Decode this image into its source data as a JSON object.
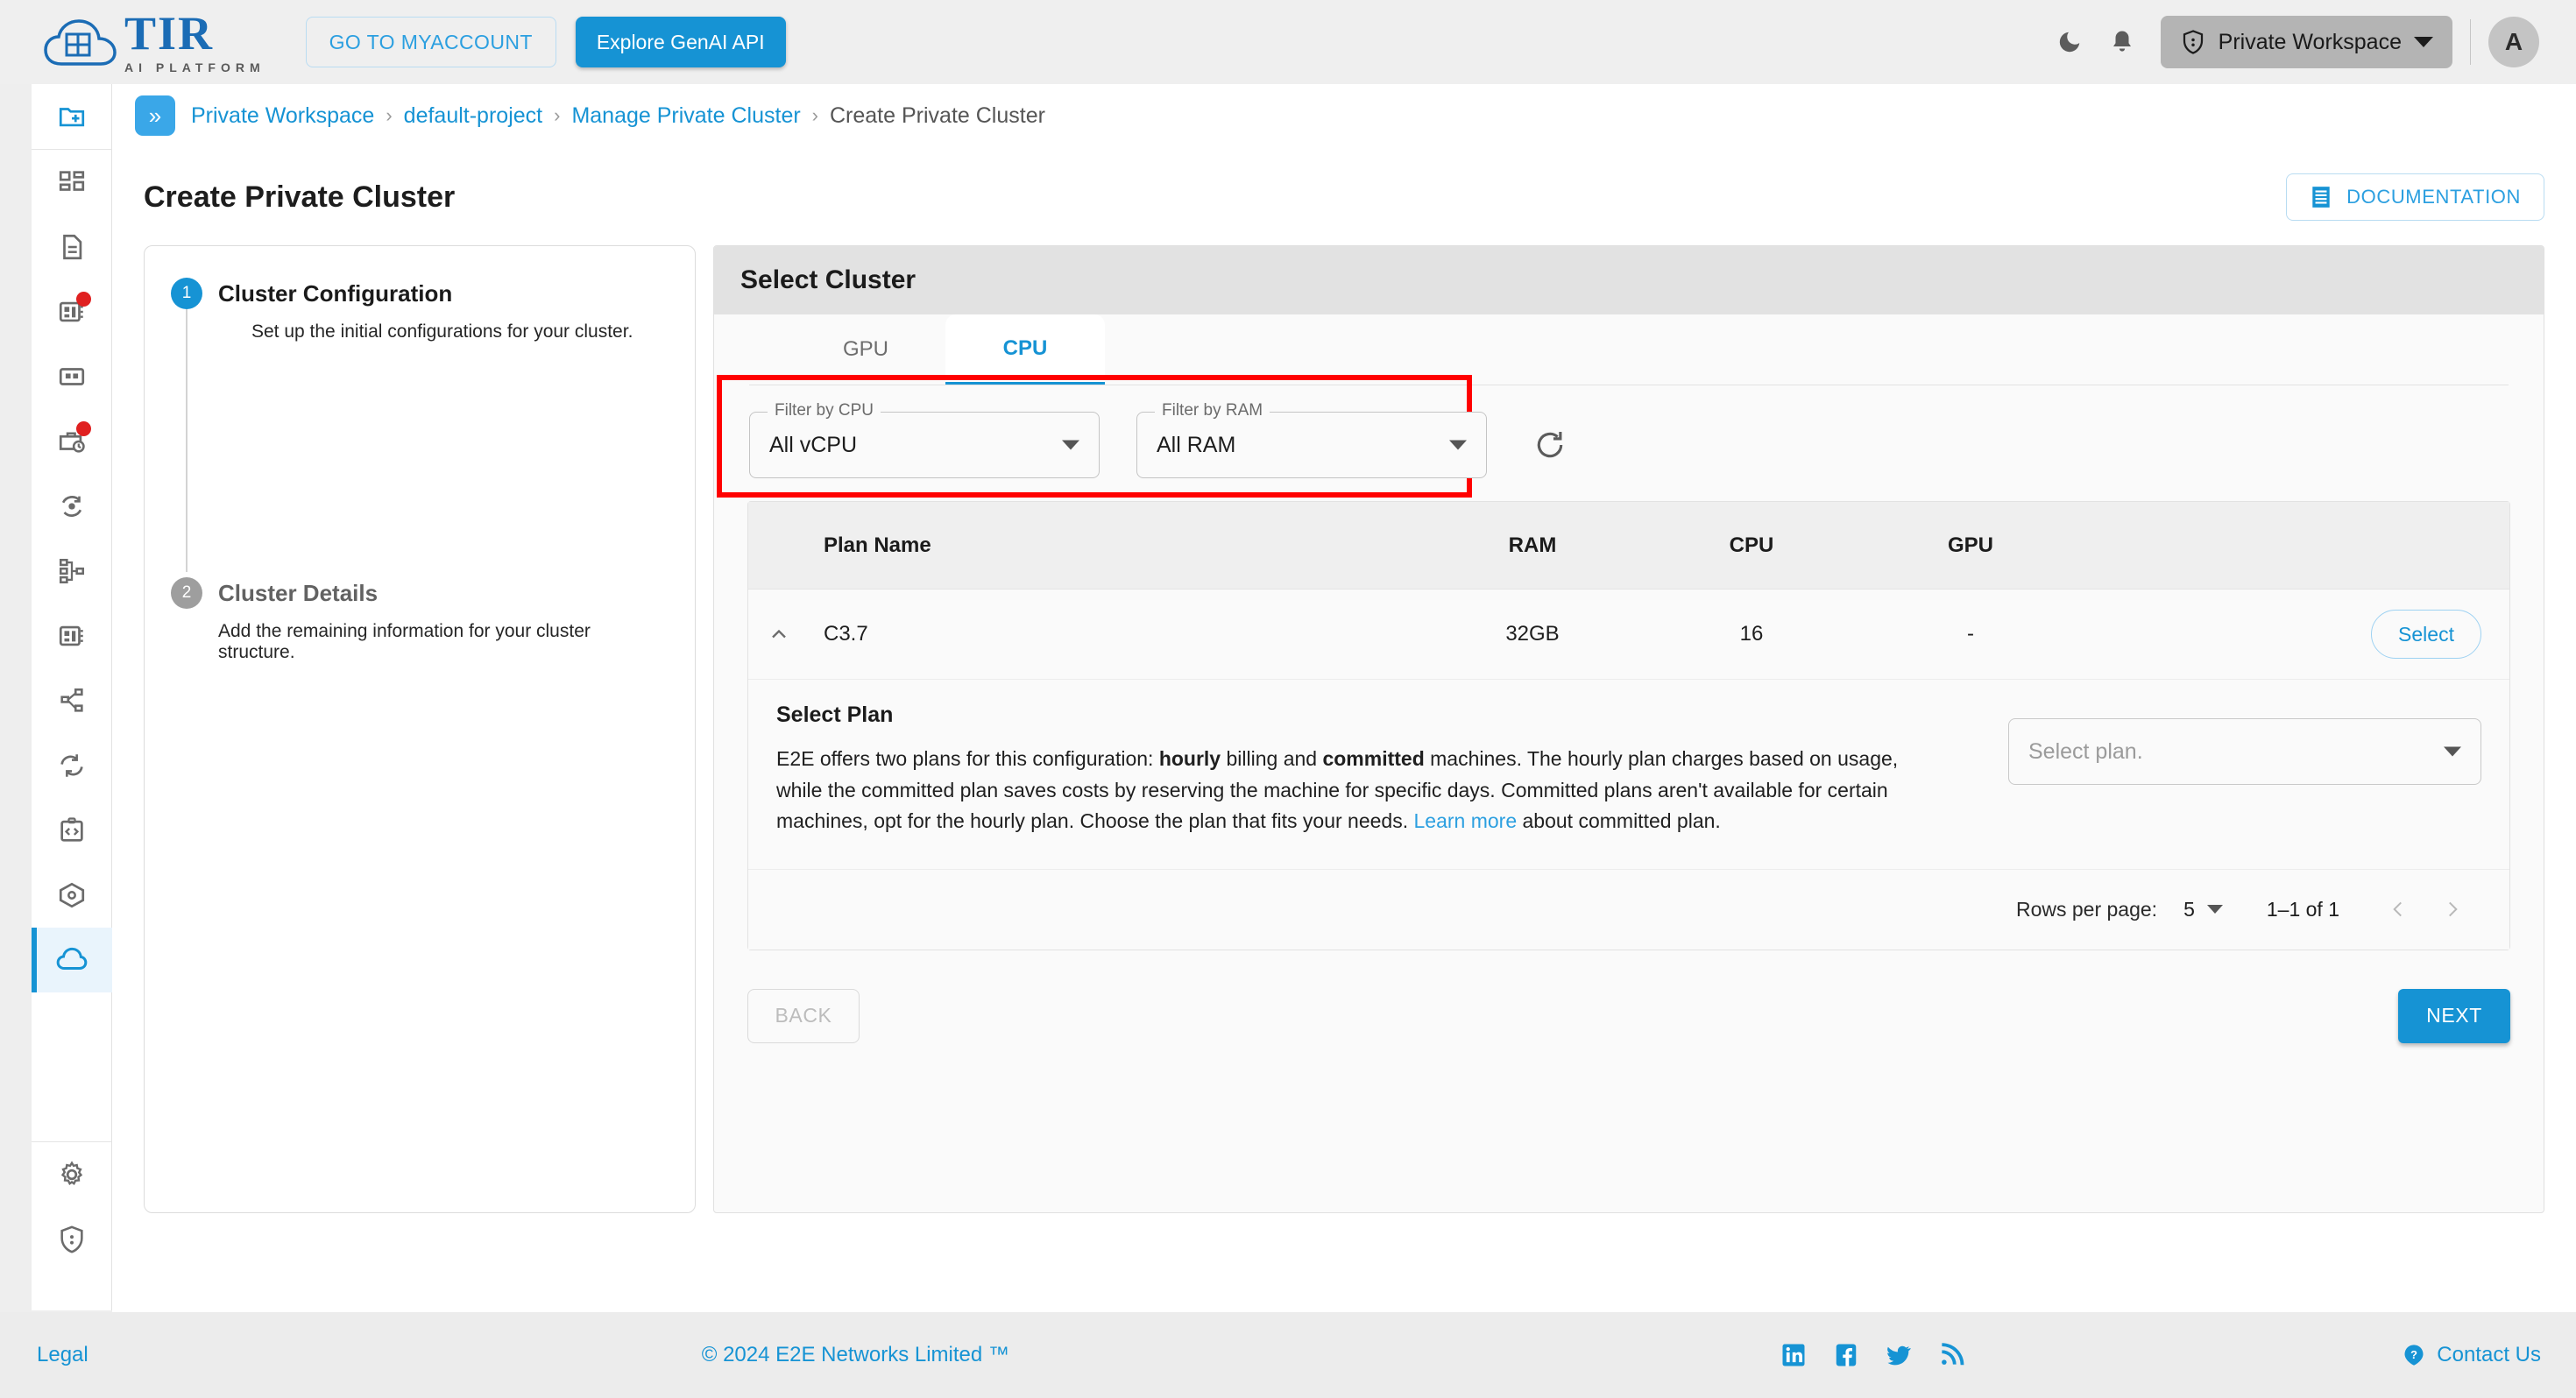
{
  "header": {
    "logo_title": "TIR",
    "logo_subtitle": "AI PLATFORM",
    "logo_cloud_label": "E2E Cloud",
    "myaccount_label": "GO TO MYACCOUNT",
    "genai_label": "Explore GenAI API",
    "workspace_label": "Private Workspace",
    "avatar_initial": "A",
    "icons": {
      "dark_mode": "moon-icon",
      "notifications": "bell-icon",
      "workspace": "shield-user-icon",
      "dropdown": "chevron-down-icon"
    }
  },
  "sidebar": {
    "items": [
      {
        "name": "new-project",
        "icon": "folder-plus-icon",
        "active": false,
        "badge": false
      },
      {
        "name": "dashboard",
        "icon": "dashboard-grid-icon",
        "active": false,
        "badge": false
      },
      {
        "name": "documents",
        "icon": "document-icon",
        "active": false,
        "badge": false
      },
      {
        "name": "notebooks",
        "icon": "notebook-card-icon",
        "active": false,
        "badge": true
      },
      {
        "name": "datasets",
        "icon": "grid-box-icon",
        "active": false,
        "badge": false
      },
      {
        "name": "jobs",
        "icon": "briefcase-clock-icon",
        "active": false,
        "badge": true
      },
      {
        "name": "pipelines",
        "icon": "refresh-node-icon",
        "active": false,
        "badge": false
      },
      {
        "name": "model-graph",
        "icon": "hierarchy-icon",
        "active": false,
        "badge": false
      },
      {
        "name": "model-cards",
        "icon": "notebook-card-icon",
        "active": false,
        "badge": false
      },
      {
        "name": "share-endpoints",
        "icon": "share-nodes-icon",
        "active": false,
        "badge": false
      },
      {
        "name": "sync",
        "icon": "sync-arrows-icon",
        "active": false,
        "badge": false
      },
      {
        "name": "code-snippets",
        "icon": "code-clipboard-icon",
        "active": false,
        "badge": false
      },
      {
        "name": "containers",
        "icon": "cube-package-icon",
        "active": false,
        "badge": false
      },
      {
        "name": "clusters",
        "icon": "cloud-icon",
        "active": true,
        "badge": false
      },
      {
        "name": "settings",
        "icon": "gear-icon",
        "active": false,
        "badge": false
      },
      {
        "name": "security",
        "icon": "shield-user-icon",
        "active": false,
        "badge": false
      }
    ]
  },
  "breadcrumb": {
    "expand_glyph": "»",
    "items": [
      {
        "label": "Private Workspace",
        "link": true
      },
      {
        "label": "default-project",
        "link": true
      },
      {
        "label": "Manage Private Cluster",
        "link": true
      },
      {
        "label": "Create Private Cluster",
        "link": false
      }
    ],
    "separator": "›"
  },
  "page": {
    "title": "Create Private Cluster",
    "documentation_label": "DOCUMENTATION"
  },
  "stepper": {
    "steps": [
      {
        "number": "1",
        "title": "Cluster Configuration",
        "description": "Set up the initial configurations for your cluster.",
        "active": true
      },
      {
        "number": "2",
        "title": "Cluster Details",
        "description": "Add the remaining information for your cluster structure.",
        "active": false
      }
    ]
  },
  "select_cluster": {
    "panel_title": "Select Cluster",
    "tabs": [
      {
        "label": "GPU",
        "active": false
      },
      {
        "label": "CPU",
        "active": true
      }
    ],
    "filters": {
      "cpu": {
        "legend": "Filter by CPU",
        "value": "All vCPU"
      },
      "ram": {
        "legend": "Filter by RAM",
        "value": "All RAM"
      },
      "refresh_icon": "refresh-icon",
      "highlight_color": "#ff0000"
    },
    "table": {
      "columns": [
        "Plan Name",
        "RAM",
        "CPU",
        "GPU"
      ],
      "rows": [
        {
          "expanded": true,
          "plan_name": "C3.7",
          "ram": "32GB",
          "cpu": "16",
          "gpu": "-",
          "action_label": "Select"
        }
      ]
    },
    "expanded_row": {
      "heading": "Select Plan",
      "paragraph_part_1": "E2E offers two plans for this configuration: ",
      "bold_1": "hourly",
      "paragraph_part_2": " billing and ",
      "bold_2": "committed",
      "paragraph_part_3": " machines. The hourly plan charges based on usage, while the committed plan saves costs by reserving the machine for specific days. Committed plans aren't available for certain machines, opt for the hourly plan. Choose the plan that fits your needs. ",
      "link_label": "Learn more",
      "paragraph_part_4": " about committed plan.",
      "plan_select_placeholder": "Select plan."
    },
    "pagination": {
      "rows_per_page_label": "Rows per page:",
      "rows_per_page_value": "5",
      "range_label": "1–1 of 1",
      "prev_icon": "chevron-left-icon",
      "next_icon": "chevron-right-icon"
    }
  },
  "wizard_nav": {
    "back_label": "BACK",
    "next_label": "NEXT"
  },
  "footer": {
    "legal_label": "Legal",
    "copyright": "© 2024 E2E Networks Limited ™",
    "social": [
      "linkedin-icon",
      "facebook-icon",
      "twitter-icon",
      "rss-icon"
    ],
    "contact_label": "Contact Us",
    "contact_icon": "question-mark-icon"
  },
  "colors": {
    "brand_blue": "#1693d4",
    "link_blue": "#2b9fe0",
    "highlight_red": "#ff0000",
    "badge_red": "#e02020"
  }
}
